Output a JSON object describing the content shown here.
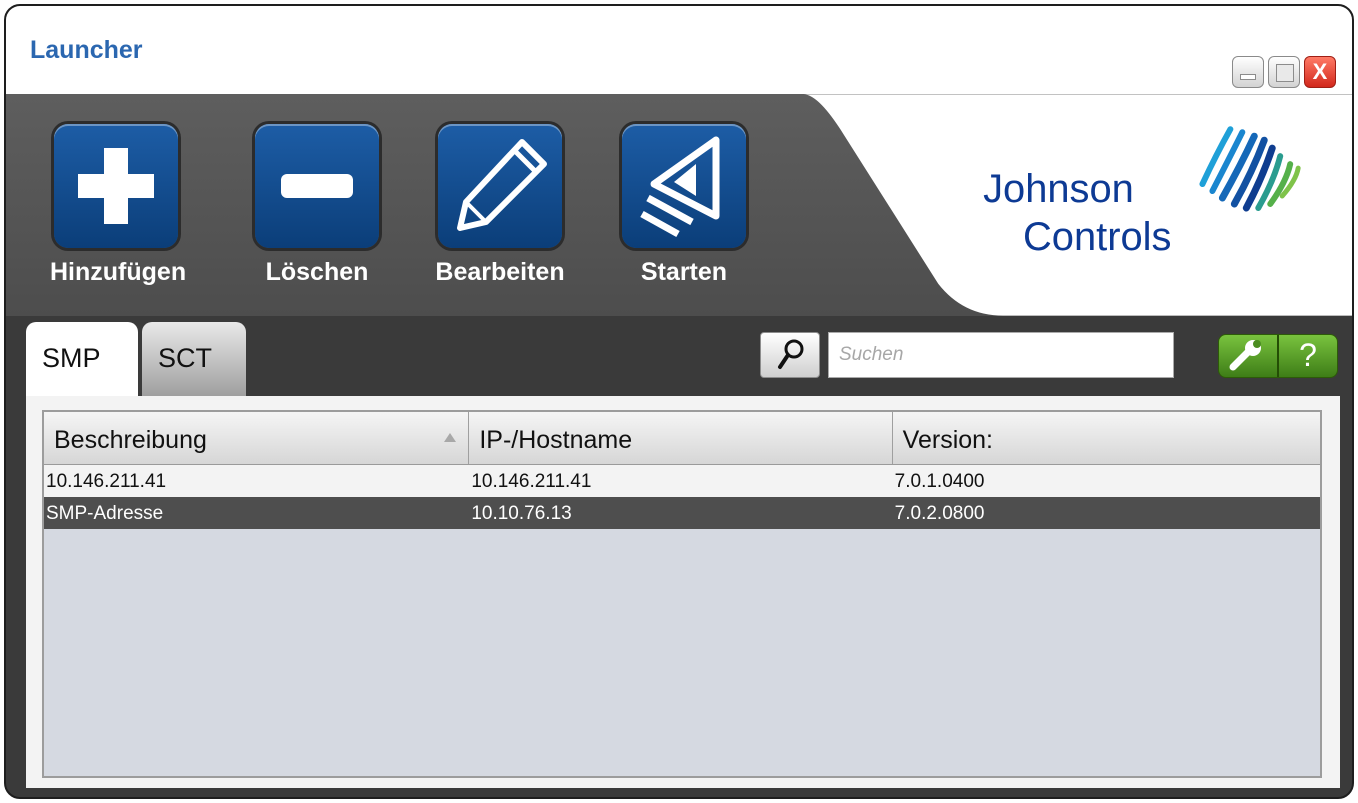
{
  "window": {
    "title": "Launcher",
    "controls": {
      "minimize": "minimize",
      "maximize": "maximize",
      "close": "X"
    }
  },
  "toolbar": {
    "buttons": [
      {
        "label": "Hinzufügen",
        "icon": "plus-icon"
      },
      {
        "label": "Löschen",
        "icon": "minus-icon"
      },
      {
        "label": "Bearbeiten",
        "icon": "pencil-icon"
      },
      {
        "label": "Starten",
        "icon": "launch-icon"
      }
    ],
    "logo": {
      "line1": "Johnson",
      "line2": "Controls"
    }
  },
  "tabs": [
    {
      "label": "SMP",
      "active": true
    },
    {
      "label": "SCT",
      "active": false
    }
  ],
  "search": {
    "placeholder": "Suchen",
    "value": ""
  },
  "settings": {
    "help_label": "?"
  },
  "table": {
    "columns": [
      "Beschreibung",
      "IP-/Hostname",
      "Version:"
    ],
    "rows": [
      {
        "cells": [
          "10.146.211.41",
          "10.146.211.41",
          "7.0.1.0400"
        ],
        "selected": false
      },
      {
        "cells": [
          "SMP-Adresse",
          "10.10.76.13",
          "7.0.2.0800"
        ],
        "selected": true
      }
    ]
  },
  "colors": {
    "title_blue": "#2b67b0",
    "button_blue": "#0b4d95",
    "header_dark": "#4f4f4f",
    "selected_row": "#4e4e4e",
    "list_background": "#d5d9e1",
    "brand_green": "#5aa72a"
  }
}
